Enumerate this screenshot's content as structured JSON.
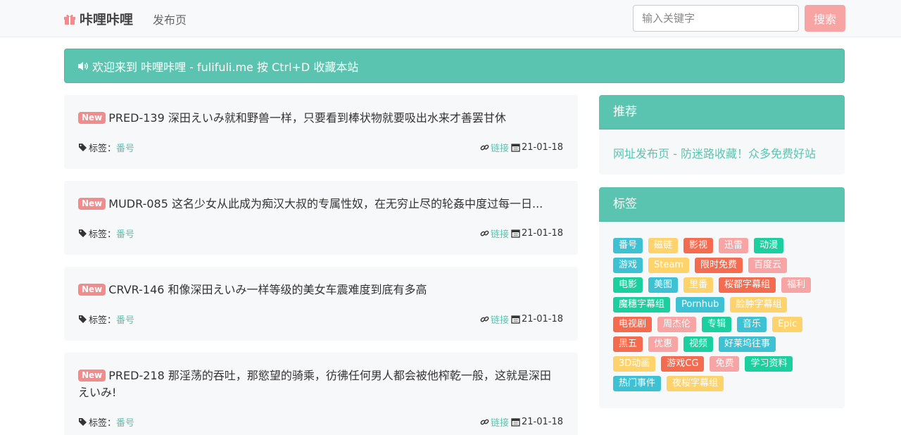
{
  "navbar": {
    "brand": "咔哩咔哩",
    "nav_link": "发布页",
    "search_placeholder": "输入关键字",
    "search_button": "搜索"
  },
  "alert": {
    "text": "欢迎来到 咔哩咔哩 - fulifuli.me 按 Ctrl+D 收藏本站"
  },
  "posts": [
    {
      "badge": "New",
      "title": "PRED-139 深田えいみ就和野兽一样，只要看到棒状物就要吸出水来才善罢甘休",
      "tag_label": "标签：",
      "tag": "番号",
      "link": "链接",
      "date": "21-01-18"
    },
    {
      "badge": "New",
      "title": "MUDR-085 这名少女从此成为痴汉大叔的专属性奴，在无穷止尽的轮姦中度过每一日...",
      "tag_label": "标签：",
      "tag": "番号",
      "link": "链接",
      "date": "21-01-18"
    },
    {
      "badge": "New",
      "title": "CRVR-146 和像深田えいみ一样等级的美女车震难度到底有多高",
      "tag_label": "标签：",
      "tag": "番号",
      "link": "链接",
      "date": "21-01-18"
    },
    {
      "badge": "New",
      "title": "PRED-218 那淫荡的吞吐，那慾望的骑乘，彷彿任何男人都会被他榨乾一般，这就是深田えいみ!",
      "tag_label": "标签：",
      "tag": "番号",
      "link": "链接",
      "date": "21-01-18"
    }
  ],
  "recommend": {
    "header": "推荐",
    "link": "网址发布页 - 防迷路收藏！众多免费好站"
  },
  "tags_card": {
    "header": "标签",
    "rows": [
      [
        {
          "label": "番号",
          "color": "#3ec1d3"
        },
        {
          "label": "磁链",
          "color": "#ffd36b"
        },
        {
          "label": "影视",
          "color": "#f46b50"
        },
        {
          "label": "迅雷",
          "color": "#f7a4a4"
        },
        {
          "label": "动漫",
          "color": "#1ccf9e"
        }
      ],
      [
        {
          "label": "游戏",
          "color": "#3ec1d3"
        },
        {
          "label": "Steam",
          "color": "#ffd36b"
        },
        {
          "label": "限时免费",
          "color": "#f46b50"
        },
        {
          "label": "百度云",
          "color": "#f7a4a4"
        }
      ],
      [
        {
          "label": "电影",
          "color": "#1ccf9e"
        },
        {
          "label": "美图",
          "color": "#3ec1d3"
        },
        {
          "label": "里番",
          "color": "#ffd36b"
        },
        {
          "label": "桜都字幕组",
          "color": "#f46b50"
        },
        {
          "label": "福利",
          "color": "#f7a4a4"
        }
      ],
      [
        {
          "label": "魔穗字幕组",
          "color": "#1ccf9e"
        },
        {
          "label": "Pornhub",
          "color": "#3ec1d3"
        },
        {
          "label": "脸肿字幕组",
          "color": "#ffd36b"
        }
      ],
      [
        {
          "label": "电视剧",
          "color": "#f46b50"
        },
        {
          "label": "周杰伦",
          "color": "#f7a4a4"
        },
        {
          "label": "专辑",
          "color": "#1ccf9e"
        },
        {
          "label": "音乐",
          "color": "#3ec1d3"
        },
        {
          "label": "Epic",
          "color": "#ffd36b"
        }
      ],
      [
        {
          "label": "黑五",
          "color": "#f46b50"
        },
        {
          "label": "优惠",
          "color": "#f7a4a4"
        },
        {
          "label": "视频",
          "color": "#1ccf9e"
        },
        {
          "label": "好莱坞往事",
          "color": "#3ec1d3"
        }
      ],
      [
        {
          "label": "3D动画",
          "color": "#ffd36b"
        },
        {
          "label": "游戏CG",
          "color": "#f46b50"
        },
        {
          "label": "免费",
          "color": "#f7a4a4"
        },
        {
          "label": "学习资料",
          "color": "#1ccf9e"
        }
      ],
      [
        {
          "label": "热门事件",
          "color": "#3ec1d3"
        },
        {
          "label": "夜桜字幕组",
          "color": "#ffd36b"
        }
      ]
    ]
  }
}
